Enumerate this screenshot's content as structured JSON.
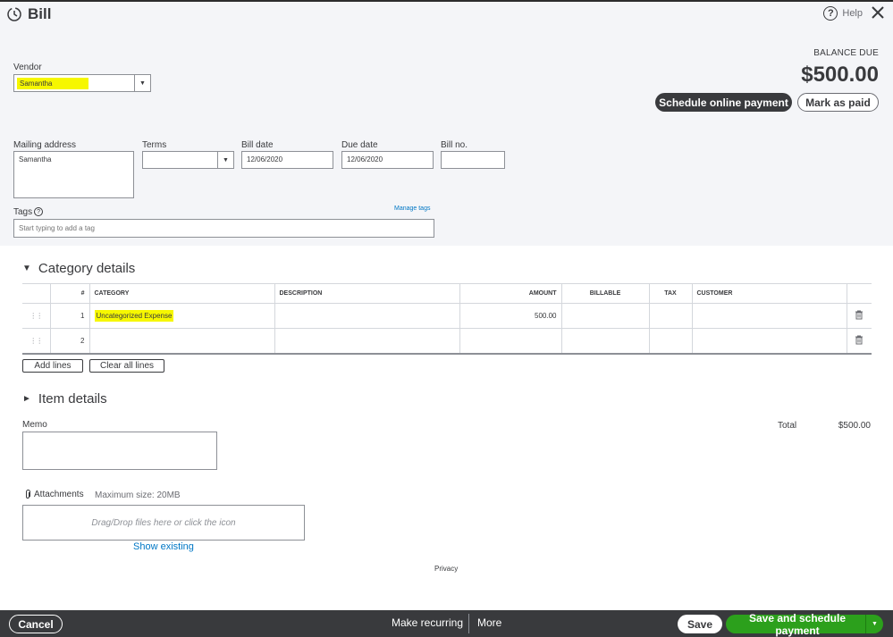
{
  "header": {
    "title": "Bill",
    "help_label": "Help"
  },
  "balance": {
    "label": "BALANCE DUE",
    "amount": "$500.00"
  },
  "actions": {
    "schedule_online": "Schedule online payment",
    "mark_paid": "Mark as paid"
  },
  "vendor": {
    "label": "Vendor",
    "value": "Samantha"
  },
  "mailing": {
    "label": "Mailing address",
    "value": "Samantha"
  },
  "terms": {
    "label": "Terms",
    "value": ""
  },
  "bill_date": {
    "label": "Bill date",
    "value": "12/06/2020"
  },
  "due_date": {
    "label": "Due date",
    "value": "12/06/2020"
  },
  "bill_no": {
    "label": "Bill no.",
    "value": ""
  },
  "tags": {
    "label": "Tags",
    "placeholder": "Start typing to add a tag",
    "manage": "Manage tags"
  },
  "category": {
    "title": "Category details",
    "columns": {
      "num": "#",
      "category": "CATEGORY",
      "description": "DESCRIPTION",
      "amount": "AMOUNT",
      "billable": "BILLABLE",
      "tax": "TAX",
      "customer": "CUSTOMER"
    },
    "rows": [
      {
        "num": "1",
        "category": "Uncategorized Expense",
        "description": "",
        "amount": "500.00",
        "billable": "",
        "tax": "",
        "customer": ""
      },
      {
        "num": "2",
        "category": "",
        "description": "",
        "amount": "",
        "billable": "",
        "tax": "",
        "customer": ""
      }
    ],
    "add_lines": "Add lines",
    "clear_lines": "Clear all lines"
  },
  "item_details": {
    "title": "Item details"
  },
  "memo": {
    "label": "Memo"
  },
  "total": {
    "label": "Total",
    "amount": "$500.00"
  },
  "attachments": {
    "label": "Attachments",
    "max_size": "Maximum size: 20MB",
    "drop_text": "Drag/Drop files here or click the icon",
    "show_existing": "Show existing"
  },
  "privacy": "Privacy",
  "footer": {
    "cancel": "Cancel",
    "make_recurring": "Make recurring",
    "more": "More",
    "save": "Save",
    "save_schedule": "Save and schedule payment"
  },
  "colors": {
    "dark": "#393a3d",
    "green": "#2ca01c",
    "highlight": "#f6f700",
    "link": "#0077c5",
    "top_bg": "#f4f5f8"
  }
}
